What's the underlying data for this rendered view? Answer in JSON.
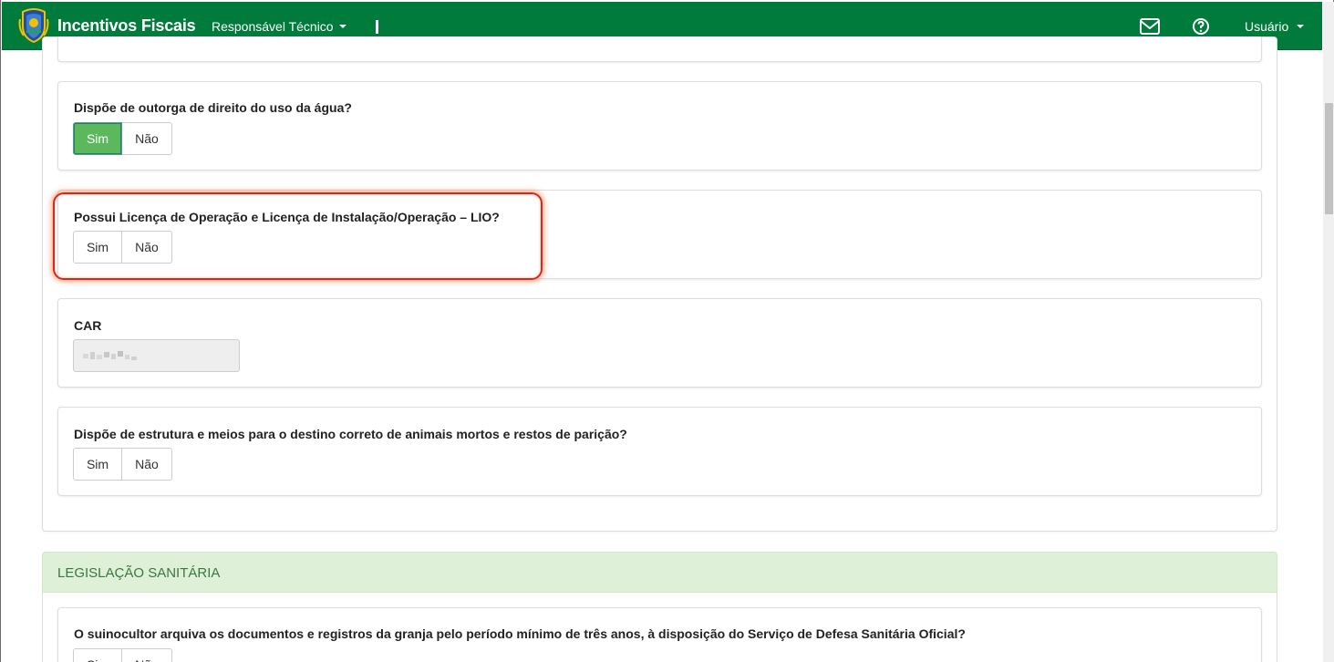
{
  "navbar": {
    "brand_title": "Incentivos Fiscais",
    "menu_label": "Responsável Técnico",
    "user_label": "Usuário",
    "bg_color": "#007b3b"
  },
  "questions": [
    {
      "label": "Dispõe de outorga de direito do uso da água?",
      "yes_label": "Sim",
      "no_label": "Não",
      "selected": "Sim"
    },
    {
      "label": "Possui Licença de Operação e Licença de Instalação/Operação – LIO?",
      "yes_label": "Sim",
      "no_label": "Não",
      "selected": null
    },
    {
      "label": "CAR",
      "value": ""
    },
    {
      "label": "Dispõe de estrutura e meios para o destino correto de animais mortos e restos de parição?",
      "yes_label": "Sim",
      "no_label": "Não",
      "selected": null
    }
  ],
  "section": {
    "title": "LEGISLAÇÃO SANITÁRIA",
    "questions": [
      {
        "label": "O suinocultor arquiva os documentos e registros da granja pelo período mínimo de três anos, à disposição do Serviço de Defesa Sanitária Oficial?",
        "yes_label": "Sim",
        "no_label": "Não",
        "selected": null
      }
    ]
  },
  "icons": {
    "logo": "state-coat-of-arms-icon",
    "mail": "envelope-icon",
    "help": "question-circle-icon",
    "caret": "caret-down-icon"
  },
  "colors": {
    "active_button": "#5cb85c",
    "highlight_border": "#e0231b",
    "section_header_bg": "#dff0d8",
    "section_header_text": "#3c763d"
  }
}
